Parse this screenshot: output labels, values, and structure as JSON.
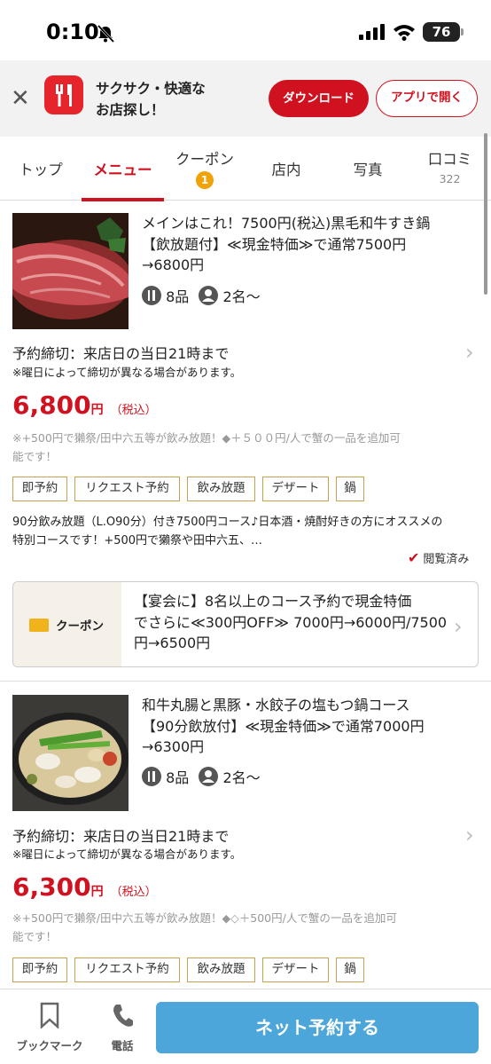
{
  "status_bar": {
    "time": "0:10",
    "battery": "76"
  },
  "app_banner": {
    "tagline_line1": "サクサク・快適な",
    "tagline_line2": "お店探し！",
    "download_label": "ダウンロード",
    "open_label": "アプリで開く"
  },
  "tabs": [
    {
      "label": "トップ"
    },
    {
      "label": "メニュー",
      "active": true
    },
    {
      "label": "クーポン",
      "badge": "1"
    },
    {
      "label": "店内"
    },
    {
      "label": "写真"
    },
    {
      "label": "口コミ",
      "count": "322"
    }
  ],
  "courses": [
    {
      "title_line1": "メインはこれ！7500円(税込)黒毛和牛すき鍋",
      "title_line2": "【飲放題付】≪現金特価≫で通常7500円",
      "title_line3": "→6800円",
      "items": "8品",
      "people": "2名〜",
      "deadline": "予約締切：来店日の当日21時まで",
      "deadline_note": "※曜日によって締切が異なる場合があります。",
      "price": "6,800",
      "yen": "円",
      "tax": "（税込）",
      "note_line1": "※+500円で獺祭/田中六五等が飲み放題！◆＋５００円/人で蟹の一品を追加可",
      "note_line2": "能です！",
      "tags": [
        "即予約",
        "リクエスト予約",
        "飲み放題",
        "デザート",
        "鍋"
      ],
      "desc_line1": "90分飲み放題（L.O90分）付き7500円コース♪日本酒・焼酎好きの方にオススメの",
      "desc_line2": "特別コースです！+500円で獺祭や田中六五、…",
      "viewed": "閲覧済み"
    },
    {
      "title_line1": "和牛丸腸と黒豚・水餃子の塩もつ鍋コース",
      "title_line2": "【90分飲放付】≪現金特価≫で通常7000円",
      "title_line3": "→6300円",
      "items": "8品",
      "people": "2名〜",
      "deadline": "予約締切：来店日の当日21時まで",
      "deadline_note": "※曜日によって締切が異なる場合があります。",
      "price": "6,300",
      "yen": "円",
      "tax": "（税込）",
      "note_line1": "※+500円で獺祭/田中六五等が飲み放題！◆◇＋500円/人で蟹の一品を追加可",
      "note_line2": "能です！",
      "tags": [
        "即予約",
        "リクエスト予約",
        "飲み放題",
        "デザート",
        "鍋"
      ]
    }
  ],
  "coupon": {
    "label": "クーポン",
    "line1": "【宴会に】8名以上のコース予約で現金特価",
    "line2": "でさらに≪300円OFF≫ 7000円→6000円/7500",
    "line3": "円→6500円"
  },
  "bottom_bar": {
    "bookmark_label": "ブックマーク",
    "phone_label": "電話",
    "reserve_label": "ネット予約する"
  },
  "colors": {
    "accent": "#d0111f",
    "reserve": "#4da6da",
    "tag_border": "#c9a24d",
    "badge": "#f0a20a"
  }
}
